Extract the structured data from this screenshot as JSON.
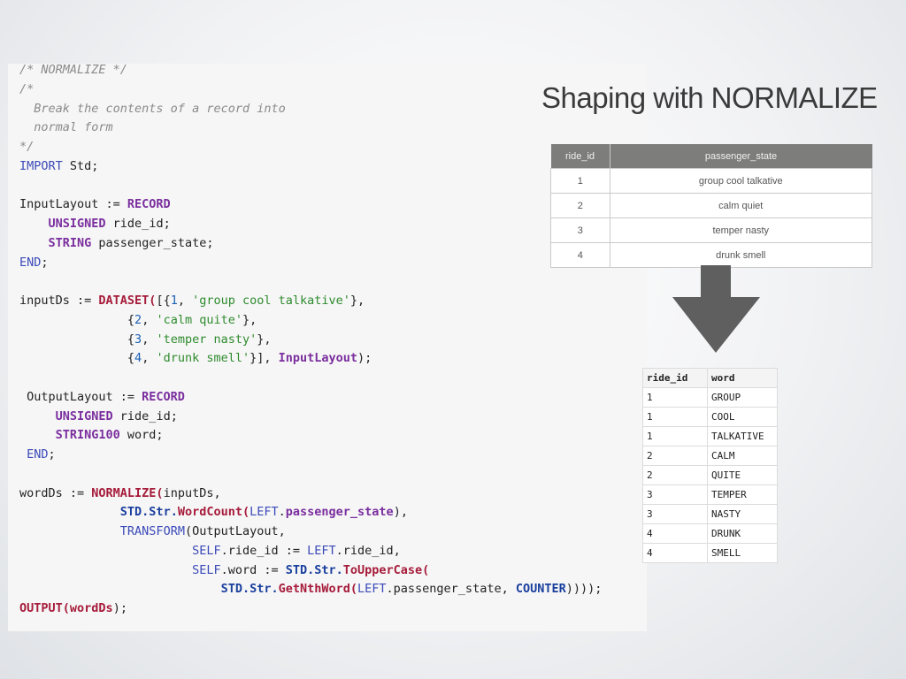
{
  "title": "Shaping with NORMALIZE",
  "code_lines": [
    [
      {
        "t": "/* NORMALIZE */",
        "c": "cmt"
      }
    ],
    [
      {
        "t": "/*",
        "c": "cmt"
      }
    ],
    [
      {
        "t": "  Break the contents of a record into",
        "c": "cmt"
      }
    ],
    [
      {
        "t": "  normal form",
        "c": "cmt"
      }
    ],
    [
      {
        "t": "*/",
        "c": "cmt"
      }
    ],
    [
      {
        "t": "IMPORT",
        "c": "kwb"
      },
      {
        "t": " Std;"
      }
    ],
    [],
    [
      {
        "t": "InputLayout := "
      },
      {
        "t": "RECORD",
        "c": "kw"
      }
    ],
    [
      {
        "t": "    "
      },
      {
        "t": "UNSIGNED",
        "c": "kw"
      },
      {
        "t": " ride_id;"
      }
    ],
    [
      {
        "t": "    "
      },
      {
        "t": "STRING",
        "c": "kw"
      },
      {
        "t": " passenger_state;"
      }
    ],
    [
      {
        "t": "END",
        "c": "kwb"
      },
      {
        "t": ";"
      }
    ],
    [],
    [
      {
        "t": "inputDs := "
      },
      {
        "t": "DATASET(",
        "c": "fn"
      },
      {
        "t": "[{"
      },
      {
        "t": "1",
        "c": "num"
      },
      {
        "t": ", "
      },
      {
        "t": "'group cool talkative'",
        "c": "str"
      },
      {
        "t": "},"
      }
    ],
    [
      {
        "t": "               {"
      },
      {
        "t": "2",
        "c": "num"
      },
      {
        "t": ", "
      },
      {
        "t": "'calm quite'",
        "c": "str"
      },
      {
        "t": "},"
      }
    ],
    [
      {
        "t": "               {"
      },
      {
        "t": "3",
        "c": "num"
      },
      {
        "t": ", "
      },
      {
        "t": "'temper nasty'",
        "c": "str"
      },
      {
        "t": "},"
      }
    ],
    [
      {
        "t": "               {"
      },
      {
        "t": "4",
        "c": "num"
      },
      {
        "t": ", "
      },
      {
        "t": "'drunk smell'",
        "c": "str"
      },
      {
        "t": "}], "
      },
      {
        "t": "InputLayout",
        "c": "kw"
      },
      {
        "t": ");"
      }
    ],
    [],
    [
      {
        "t": " OutputLayout := "
      },
      {
        "t": "RECORD",
        "c": "kw"
      }
    ],
    [
      {
        "t": "     "
      },
      {
        "t": "UNSIGNED",
        "c": "kw"
      },
      {
        "t": " ride_id;"
      }
    ],
    [
      {
        "t": "     "
      },
      {
        "t": "STRING100",
        "c": "kw"
      },
      {
        "t": " word;"
      }
    ],
    [
      {
        "t": " "
      },
      {
        "t": "END",
        "c": "kwb"
      },
      {
        "t": ";"
      }
    ],
    [],
    [
      {
        "t": "wordDs := "
      },
      {
        "t": "NORMALIZE(",
        "c": "fn"
      },
      {
        "t": "inputDs,"
      }
    ],
    [
      {
        "t": "              "
      },
      {
        "t": "STD.Str.",
        "c": "std"
      },
      {
        "t": "WordCount(",
        "c": "fn"
      },
      {
        "t": "LEFT",
        "c": "kwb"
      },
      {
        "t": "."
      },
      {
        "t": "passenger_state",
        "c": "kw"
      },
      {
        "t": "),"
      }
    ],
    [
      {
        "t": "              "
      },
      {
        "t": "TRANSFORM",
        "c": "kwb"
      },
      {
        "t": "(OutputLayout,"
      }
    ],
    [
      {
        "t": "                        "
      },
      {
        "t": "SELF",
        "c": "kwb"
      },
      {
        "t": ".ride_id := "
      },
      {
        "t": "LEFT",
        "c": "kwb"
      },
      {
        "t": ".ride_id,"
      }
    ],
    [
      {
        "t": "                        "
      },
      {
        "t": "SELF",
        "c": "kwb"
      },
      {
        "t": ".word := "
      },
      {
        "t": "STD.Str.",
        "c": "std"
      },
      {
        "t": "ToUpperCase(",
        "c": "fn"
      }
    ],
    [
      {
        "t": "                            "
      },
      {
        "t": "STD.Str.",
        "c": "std"
      },
      {
        "t": "GetNthWord(",
        "c": "fn"
      },
      {
        "t": "LEFT",
        "c": "kwb"
      },
      {
        "t": ".passenger_state, "
      },
      {
        "t": "COUNTER",
        "c": "std"
      },
      {
        "t": "))));"
      }
    ],
    [
      {
        "t": "OUTPUT(",
        "c": "fn"
      },
      {
        "t": "wordDs",
        "c": "fn"
      },
      {
        "t": ");"
      }
    ]
  ],
  "input_table": {
    "headers": [
      "ride_id",
      "passenger_state"
    ],
    "rows": [
      [
        "1",
        "group cool talkative"
      ],
      [
        "2",
        "calm quiet"
      ],
      [
        "3",
        "temper nasty"
      ],
      [
        "4",
        "drunk smell"
      ]
    ]
  },
  "output_table": {
    "headers": [
      "ride_id",
      "word"
    ],
    "rows": [
      [
        "1",
        "GROUP"
      ],
      [
        "1",
        "COOL"
      ],
      [
        "1",
        "TALKATIVE"
      ],
      [
        "2",
        "CALM"
      ],
      [
        "2",
        "QUITE"
      ],
      [
        "3",
        "TEMPER"
      ],
      [
        "3",
        "NASTY"
      ],
      [
        "4",
        "DRUNK"
      ],
      [
        "4",
        "SMELL"
      ]
    ]
  },
  "arrow_icon": "down-arrow-icon",
  "colors": {
    "table_header_bg": "#7d7d7b",
    "arrow": "#5f5f5f",
    "code_bg": "#f6f6f6"
  }
}
